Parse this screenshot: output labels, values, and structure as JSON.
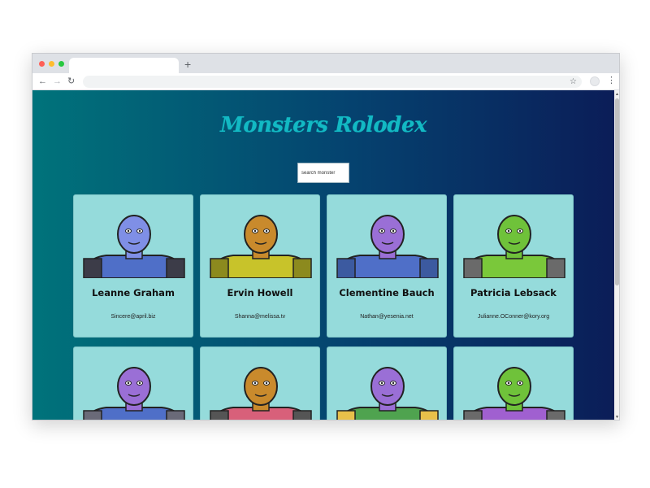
{
  "page": {
    "title": "Monsters Rolodex",
    "search_placeholder": "search monster"
  },
  "colors": {
    "title": "#12b9c4",
    "card_background": "#95dbdb",
    "gradient_start": "#00737b",
    "gradient_end": "#0b1d58"
  },
  "monsters": [
    {
      "name": "Leanne Graham",
      "email": "Sincere@april.biz",
      "skin": "#7f8fe6",
      "body": "#4f6fc8",
      "accent": "#3c3c48"
    },
    {
      "name": "Ervin Howell",
      "email": "Shanna@melissa.tv",
      "skin": "#c98a2c",
      "body": "#c8c32a",
      "accent": "#8c8a1e"
    },
    {
      "name": "Clementine Bauch",
      "email": "Nathan@yesenia.net",
      "skin": "#9a6fd6",
      "body": "#4f6fc8",
      "accent": "#3c5aa0"
    },
    {
      "name": "Patricia Lebsack",
      "email": "Julianne.OConner@kory.org",
      "skin": "#6fc23a",
      "body": "#7ac83a",
      "accent": "#6a6a6a"
    },
    {
      "name": "",
      "email": "",
      "skin": "#9a6fd6",
      "body": "#4f6fc8",
      "accent": "#6a6a78"
    },
    {
      "name": "",
      "email": "",
      "skin": "#c98a2c",
      "body": "#d8607a",
      "accent": "#555"
    },
    {
      "name": "",
      "email": "",
      "skin": "#9a6fd6",
      "body": "#4fa34f",
      "accent": "#e8c04a"
    },
    {
      "name": "",
      "email": "",
      "skin": "#6fc23a",
      "body": "#a060d0",
      "accent": "#6a6a6a"
    }
  ],
  "icons": {
    "back": "arrow-left-icon",
    "forward": "arrow-right-icon",
    "reload": "reload-icon",
    "bookmark": "star-icon",
    "menu": "kebab-menu-icon",
    "new_tab": "plus-icon"
  }
}
